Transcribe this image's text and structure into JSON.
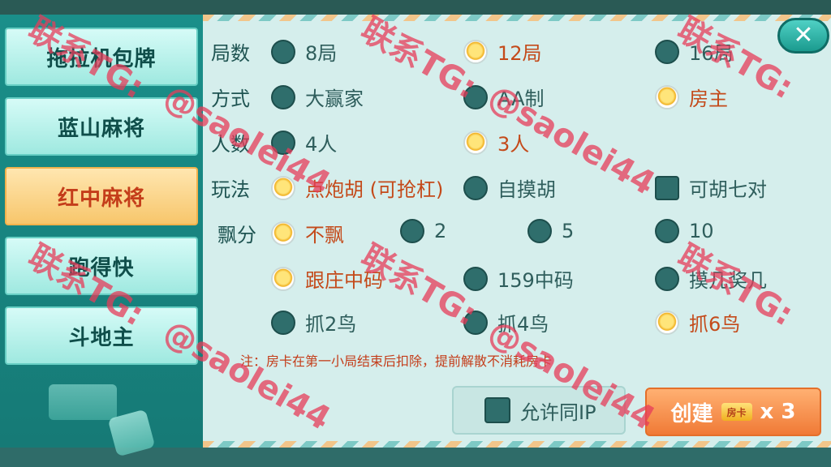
{
  "tabs": [
    {
      "label": "拖拉机包牌",
      "active": false
    },
    {
      "label": "蓝山麻将",
      "active": false
    },
    {
      "label": "红中麻将",
      "active": true
    },
    {
      "label": "跑得快",
      "active": false
    },
    {
      "label": "斗地主",
      "active": false
    }
  ],
  "rows": {
    "rounds": {
      "label": "局数",
      "options": [
        {
          "label": "8局",
          "selected": false
        },
        {
          "label": "12局",
          "selected": true
        },
        {
          "label": "16局",
          "selected": false
        }
      ]
    },
    "mode": {
      "label": "方式",
      "options": [
        {
          "label": "大赢家",
          "selected": false
        },
        {
          "label": "AA制",
          "selected": false
        },
        {
          "label": "房主",
          "selected": true
        }
      ]
    },
    "players": {
      "label": "人数",
      "options": [
        {
          "label": "4人",
          "selected": false
        },
        {
          "label": "3人",
          "selected": true
        }
      ]
    },
    "rules": {
      "label": "玩法",
      "options": [
        {
          "label": "点炮胡 (可抢杠)",
          "selected": true
        },
        {
          "label": "自摸胡",
          "selected": false
        },
        {
          "label": "可胡七对",
          "checked": false
        }
      ]
    },
    "piao": {
      "label": "飘分",
      "options": [
        {
          "label": "不飘",
          "selected": true
        },
        {
          "label": "2",
          "selected": false
        },
        {
          "label": "5",
          "selected": false
        },
        {
          "label": "10",
          "selected": false
        }
      ]
    },
    "zhongma": {
      "options": [
        {
          "label": "跟庄中码",
          "selected": true
        },
        {
          "label": "159中码",
          "selected": false
        },
        {
          "label": "摸几奖几",
          "selected": false
        }
      ]
    },
    "birds": {
      "options": [
        {
          "label": "抓2鸟",
          "selected": false
        },
        {
          "label": "抓4鸟",
          "selected": false
        },
        {
          "label": "抓6鸟",
          "selected": true
        }
      ]
    }
  },
  "note": "注：房卡在第一小局结束后扣除，提前解散不消耗房卡",
  "allow_ip": {
    "label": "允许同IP",
    "checked": false
  },
  "create": {
    "label": "创建",
    "card_icon_text": "房卡",
    "count": "x 3"
  },
  "close_icon": "✕",
  "watermarks": [
    "联系TG:",
    "@saolei44"
  ],
  "colors": {
    "accent": "#c44a1a",
    "panel": "#d5eeec",
    "teal": "#167a76"
  }
}
